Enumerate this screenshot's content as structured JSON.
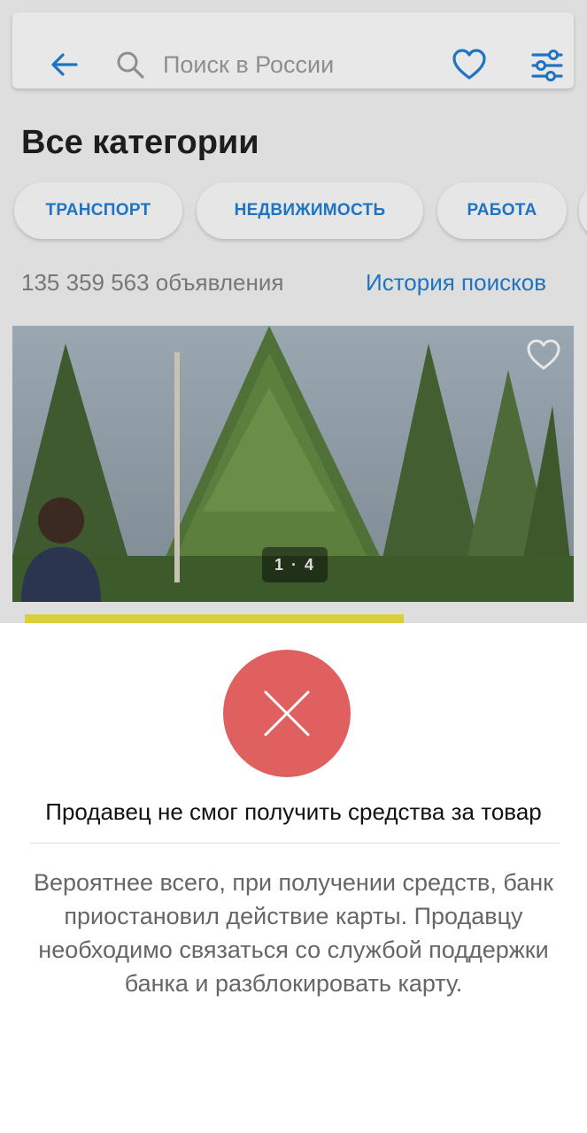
{
  "search": {
    "placeholder": "Поиск в России"
  },
  "categories": {
    "title": "Все категории",
    "chips": [
      "ТРАНСПОРТ",
      "НЕДВИЖИМОСТЬ",
      "РАБОТА"
    ]
  },
  "stats": {
    "ads_count": "135 359 563 объявления",
    "history_link": "История поисков"
  },
  "listing": {
    "image_counter": "1 · 4"
  },
  "error_dialog": {
    "title": "Продавец не смог получить средства за товар",
    "message": "Вероятнее всего, при получении средств, банк приостановил действие карты. Продавцу необходимо связаться со службой поддержки банка и разблокировать карту."
  },
  "colors": {
    "accent": "#1e74c3",
    "error": "#e06060",
    "strip": "#d9cf3c"
  },
  "icons": [
    "back-arrow-icon",
    "search-icon",
    "heart-icon",
    "filter-icon",
    "close-icon"
  ]
}
